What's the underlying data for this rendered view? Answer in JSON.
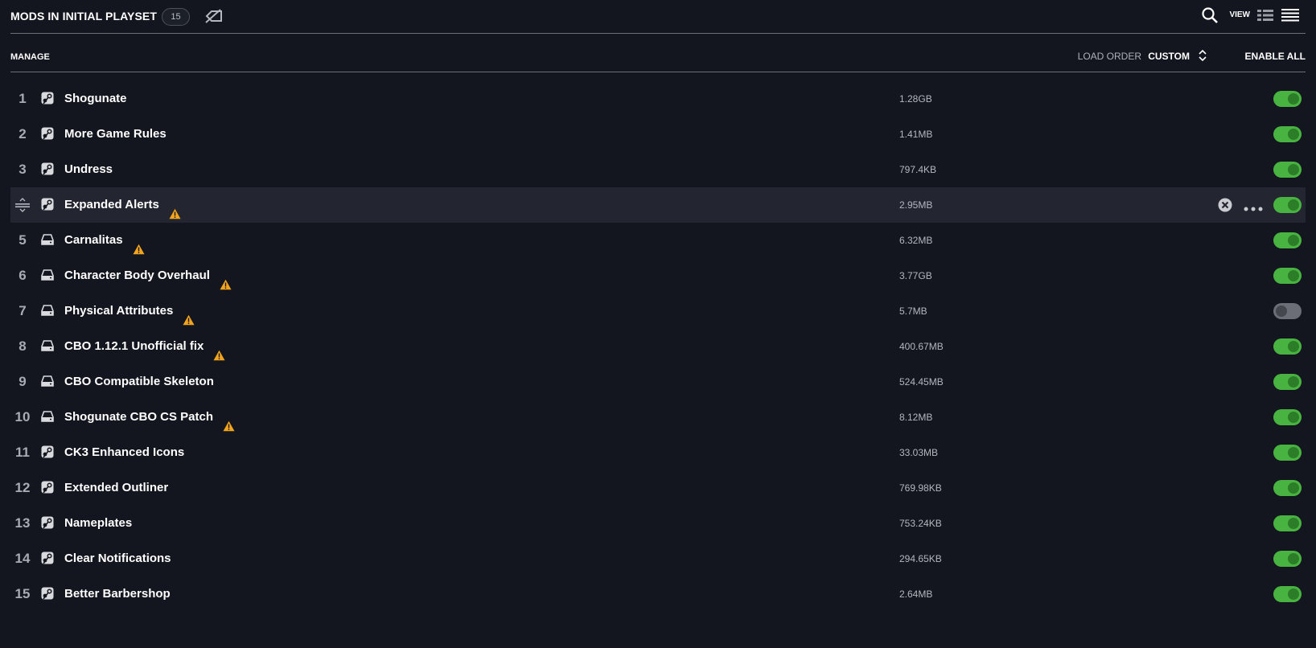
{
  "header": {
    "title": "MODS IN INITIAL PLAYSET",
    "count": "15",
    "view_label": "VIEW"
  },
  "toolbar": {
    "manage_label": "MANAGE",
    "load_order_label": "LOAD ORDER",
    "load_order_value": "CUSTOM",
    "enable_all_label": "ENABLE ALL"
  },
  "colors": {
    "background": "#13161f",
    "toggle_on": "#49b341",
    "toggle_off": "#6b6e76",
    "warning": "#f2a41e",
    "hover_row": "#232630"
  },
  "mods": [
    {
      "index": "1",
      "name": "Shogunate",
      "size": "1.28GB",
      "source": "steam-icon",
      "warning": false,
      "enabled": true
    },
    {
      "index": "2",
      "name": "More Game Rules",
      "size": "1.41MB",
      "source": "steam-icon",
      "warning": false,
      "enabled": true
    },
    {
      "index": "3",
      "name": "Undress",
      "size": "797.4KB",
      "source": "steam-icon",
      "warning": false,
      "enabled": true
    },
    {
      "index": "4",
      "name": "Expanded Alerts",
      "size": "2.95MB",
      "source": "steam-icon",
      "warning": true,
      "enabled": true,
      "hovered": true
    },
    {
      "index": "5",
      "name": "Carnalitas",
      "size": "6.32MB",
      "source": "local-drive-icon",
      "warning": true,
      "enabled": true
    },
    {
      "index": "6",
      "name": "Character Body Overhaul",
      "size": "3.77GB",
      "source": "local-drive-icon",
      "warning": true,
      "enabled": true
    },
    {
      "index": "7",
      "name": "Physical Attributes",
      "size": "5.7MB",
      "source": "local-drive-icon",
      "warning": true,
      "enabled": false
    },
    {
      "index": "8",
      "name": "CBO 1.12.1 Unofficial fix",
      "size": "400.67MB",
      "source": "local-drive-icon",
      "warning": true,
      "enabled": true
    },
    {
      "index": "9",
      "name": "CBO Compatible Skeleton",
      "size": "524.45MB",
      "source": "local-drive-icon",
      "warning": false,
      "enabled": true
    },
    {
      "index": "10",
      "name": "Shogunate CBO CS Patch",
      "size": "8.12MB",
      "source": "local-drive-icon",
      "warning": true,
      "enabled": true
    },
    {
      "index": "11",
      "name": "CK3 Enhanced Icons",
      "size": "33.03MB",
      "source": "steam-icon",
      "warning": false,
      "enabled": true
    },
    {
      "index": "12",
      "name": "Extended Outliner",
      "size": "769.98KB",
      "source": "steam-icon",
      "warning": false,
      "enabled": true
    },
    {
      "index": "13",
      "name": "Nameplates",
      "size": "753.24KB",
      "source": "steam-icon",
      "warning": false,
      "enabled": true
    },
    {
      "index": "14",
      "name": "Clear Notifications",
      "size": "294.65KB",
      "source": "steam-icon",
      "warning": false,
      "enabled": true
    },
    {
      "index": "15",
      "name": "Better Barbershop",
      "size": "2.64MB",
      "source": "steam-icon",
      "warning": false,
      "enabled": true
    }
  ]
}
